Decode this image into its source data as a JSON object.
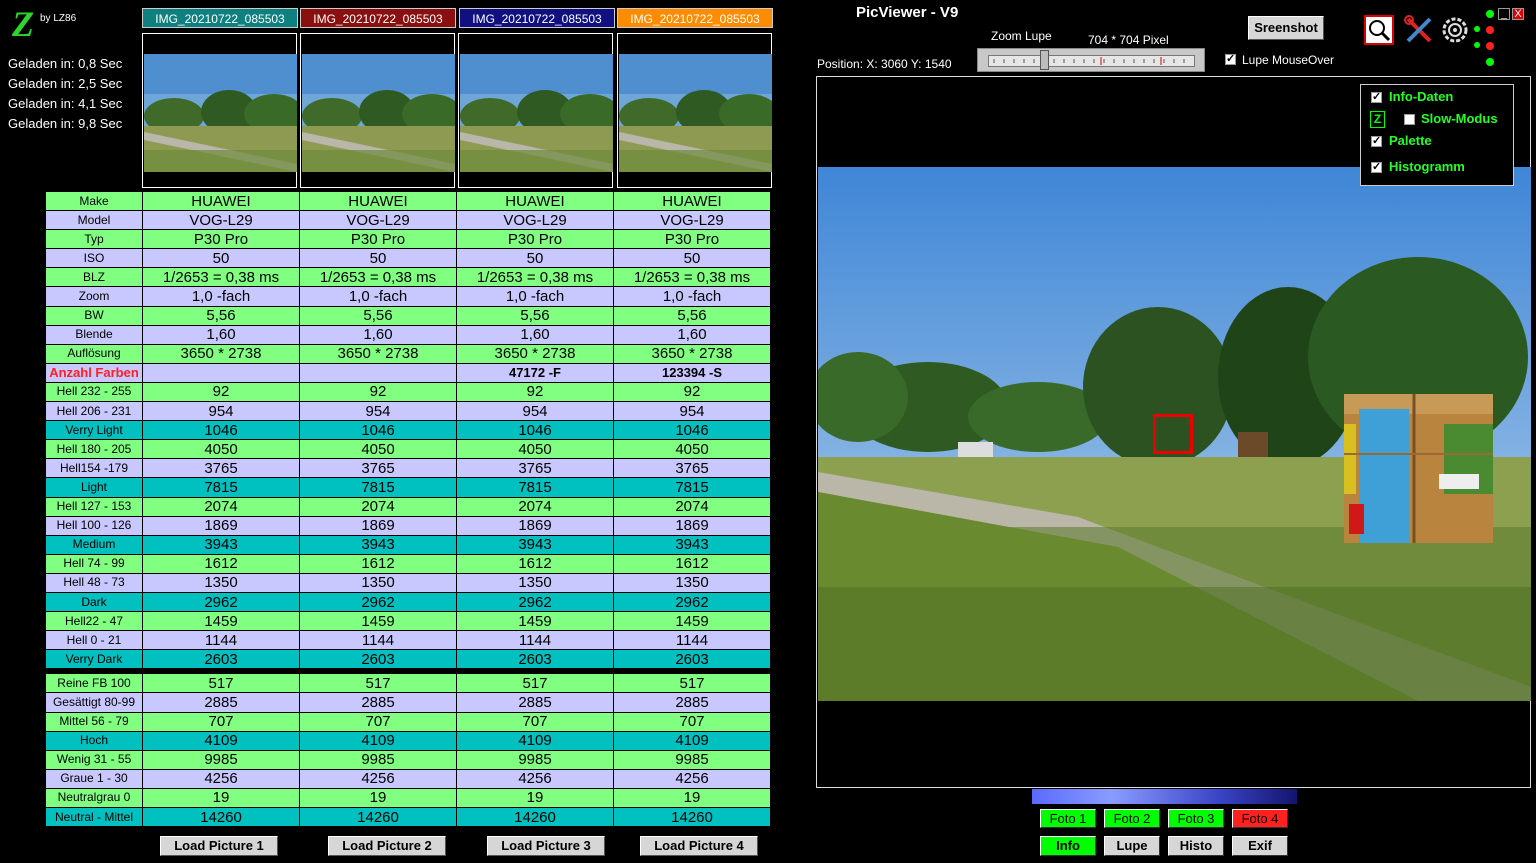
{
  "logo": {
    "mark": "Z",
    "by": "by LZ86"
  },
  "timings": [
    "Geladen in: 0,8 Sec",
    "Geladen in: 2,5 Sec",
    "Geladen in: 4,1 Sec",
    "Geladen in: 9,8 Sec"
  ],
  "images": [
    {
      "name": "IMG_20210722_085503",
      "color": "#0e8080"
    },
    {
      "name": "IMG_20210722_085503",
      "color": "#8a1010"
    },
    {
      "name": "IMG_20210722_085503",
      "color": "#101080"
    },
    {
      "name": "IMG_20210722_085503",
      "color": "#ff8c00"
    }
  ],
  "table": {
    "rows": [
      {
        "label": "Make",
        "style": "g",
        "values": [
          "HUAWEI",
          "HUAWEI",
          "HUAWEI",
          "HUAWEI"
        ]
      },
      {
        "label": "Model",
        "style": "l",
        "values": [
          "VOG-L29",
          "VOG-L29",
          "VOG-L29",
          "VOG-L29"
        ]
      },
      {
        "label": "Typ",
        "style": "g",
        "values": [
          "P30 Pro",
          "P30 Pro",
          "P30 Pro",
          "P30 Pro"
        ]
      },
      {
        "label": "ISO",
        "style": "l",
        "values": [
          "50",
          "50",
          "50",
          "50"
        ]
      },
      {
        "label": "BLZ",
        "style": "g",
        "values": [
          "1/2653 = 0,38 ms",
          "1/2653 = 0,38 ms",
          "1/2653 = 0,38 ms",
          "1/2653 = 0,38 ms"
        ]
      },
      {
        "label": "Zoom",
        "style": "l",
        "values": [
          "1,0 -fach",
          "1,0 -fach",
          "1,0 -fach",
          "1,0 -fach"
        ]
      },
      {
        "label": "BW",
        "style": "g",
        "values": [
          "5,56",
          "5,56",
          "5,56",
          "5,56"
        ]
      },
      {
        "label": "Blende",
        "style": "l",
        "values": [
          "1,60",
          "1,60",
          "1,60",
          "1,60"
        ]
      },
      {
        "label": "Auflösung",
        "style": "g",
        "values": [
          "3650 * 2738",
          "3650 * 2738",
          "3650 * 2738",
          "3650 * 2738"
        ]
      },
      {
        "label": "Anzahl Farben",
        "style": "l",
        "red": true,
        "bold": true,
        "values": [
          "",
          "",
          "47172 -F",
          "123394 -S"
        ]
      },
      {
        "label": "Hell 232 - 255",
        "style": "g",
        "values": [
          "92",
          "92",
          "92",
          "92"
        ]
      },
      {
        "label": "Hell 206 - 231",
        "style": "l",
        "values": [
          "954",
          "954",
          "954",
          "954"
        ]
      },
      {
        "label": "Verry Light",
        "style": "c",
        "values": [
          "1046",
          "1046",
          "1046",
          "1046"
        ]
      },
      {
        "label": "Hell 180 - 205",
        "style": "g",
        "values": [
          "4050",
          "4050",
          "4050",
          "4050"
        ]
      },
      {
        "label": "Hell154 -179",
        "style": "l",
        "values": [
          "3765",
          "3765",
          "3765",
          "3765"
        ]
      },
      {
        "label": "Light",
        "style": "c",
        "values": [
          "7815",
          "7815",
          "7815",
          "7815"
        ]
      },
      {
        "label": "Hell 127 - 153",
        "style": "g",
        "values": [
          "2074",
          "2074",
          "2074",
          "2074"
        ]
      },
      {
        "label": "Hell 100 - 126",
        "style": "l",
        "values": [
          "1869",
          "1869",
          "1869",
          "1869"
        ]
      },
      {
        "label": "Medium",
        "style": "c",
        "values": [
          "3943",
          "3943",
          "3943",
          "3943"
        ]
      },
      {
        "label": "Hell 74 - 99",
        "style": "g",
        "values": [
          "1612",
          "1612",
          "1612",
          "1612"
        ]
      },
      {
        "label": "Hell 48 - 73",
        "style": "l",
        "values": [
          "1350",
          "1350",
          "1350",
          "1350"
        ]
      },
      {
        "label": "Dark",
        "style": "c",
        "values": [
          "2962",
          "2962",
          "2962",
          "2962"
        ]
      },
      {
        "label": "Hell22 - 47",
        "style": "g",
        "values": [
          "1459",
          "1459",
          "1459",
          "1459"
        ]
      },
      {
        "label": "Hell 0 - 21",
        "style": "l",
        "values": [
          "1144",
          "1144",
          "1144",
          "1144"
        ]
      },
      {
        "label": "Verry Dark",
        "style": "c",
        "values": [
          "2603",
          "2603",
          "2603",
          "2603"
        ]
      },
      {
        "label": "",
        "style": "gap",
        "values": []
      },
      {
        "label": "Reine FB 100",
        "style": "g",
        "values": [
          "517",
          "517",
          "517",
          "517"
        ]
      },
      {
        "label": "Gesättigt 80-99",
        "style": "l",
        "values": [
          "2885",
          "2885",
          "2885",
          "2885"
        ]
      },
      {
        "label": "Mittel 56 - 79",
        "style": "g",
        "values": [
          "707",
          "707",
          "707",
          "707"
        ]
      },
      {
        "label": "Hoch",
        "style": "c",
        "values": [
          "4109",
          "4109",
          "4109",
          "4109"
        ]
      },
      {
        "label": "Wenig 31 - 55",
        "style": "g",
        "values": [
          "9985",
          "9985",
          "9985",
          "9985"
        ]
      },
      {
        "label": "Graue 1 - 30",
        "style": "l",
        "values": [
          "4256",
          "4256",
          "4256",
          "4256"
        ]
      },
      {
        "label": "Neutralgrau 0",
        "style": "g",
        "values": [
          "19",
          "19",
          "19",
          "19"
        ]
      },
      {
        "label": "Neutral - Mittel",
        "style": "c",
        "values": [
          "14260",
          "14260",
          "14260",
          "14260"
        ]
      }
    ]
  },
  "load_buttons": [
    "Load Picture 1",
    "Load Picture 2",
    "Load Picture 3",
    "Load Picture 4"
  ],
  "viewer": {
    "title": "PicViewer - V9",
    "zoom_label": "Zoom Lupe",
    "pixel_label": "704 * 704 Pixel",
    "position": "Position: X: 3060  Y: 1540",
    "lupe_mouseover": "Lupe MouseOver",
    "lupe_mouseover_checked": true,
    "screenshot_button": "Sreenshot",
    "options": [
      {
        "label": "Info-Daten",
        "checked": true
      },
      {
        "label": "Slow-Modus",
        "checked": false
      },
      {
        "label": "Palette",
        "checked": true
      },
      {
        "label": "Histogramm",
        "checked": true
      }
    ],
    "foto_buttons": [
      {
        "label": "Foto 1",
        "color": "#00ff00"
      },
      {
        "label": "Foto 2",
        "color": "#00ff00"
      },
      {
        "label": "Foto 3",
        "color": "#00ff00"
      },
      {
        "label": "Foto 4",
        "color": "#ff2020"
      }
    ],
    "bottom_buttons": [
      "Info",
      "Lupe",
      "Histo",
      "Exif"
    ],
    "window_controls": {
      "minimize": "_",
      "close": "X"
    }
  }
}
